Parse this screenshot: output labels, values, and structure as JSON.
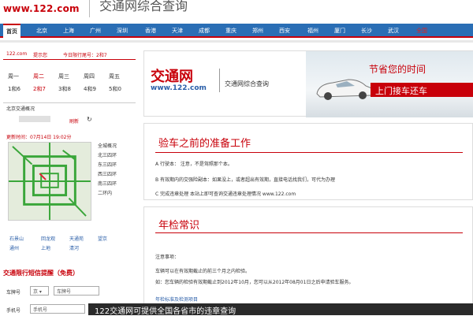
{
  "header": {
    "logo_url": "www.122.com",
    "title": "交通网综合查询"
  },
  "nav": {
    "items": [
      {
        "label": "首页",
        "type": "home"
      },
      {
        "label": "北京",
        "type": "normal"
      },
      {
        "label": "上海",
        "type": "normal"
      },
      {
        "label": "广州",
        "type": "normal"
      },
      {
        "label": "深圳",
        "type": "normal"
      },
      {
        "label": "香港",
        "type": "normal"
      },
      {
        "label": "天津",
        "type": "normal"
      },
      {
        "label": "成都",
        "type": "normal"
      },
      {
        "label": "重庆",
        "type": "normal"
      },
      {
        "label": "郑州",
        "type": "normal"
      },
      {
        "label": "西安",
        "type": "normal"
      },
      {
        "label": "福州",
        "type": "normal"
      },
      {
        "label": "厦门",
        "type": "normal"
      },
      {
        "label": "长沙",
        "type": "normal"
      },
      {
        "label": "武汉",
        "type": "normal"
      },
      {
        "label": "全国",
        "type": "red"
      }
    ]
  },
  "limit": {
    "site": "122.com",
    "tip": "提示您",
    "today": "今日限行尾号：2和7"
  },
  "week": {
    "days": [
      "周一",
      "周二",
      "周三",
      "周四",
      "周五"
    ],
    "numbers": [
      "1和6",
      "2和7",
      "3和8",
      "4和9",
      "5和0"
    ]
  },
  "traffic": {
    "title": "北京交通概况",
    "refresh": "刷新",
    "update_time": "更新时间：07月14日 19:02分",
    "roads": [
      "全城概况",
      "北三四环",
      "东三四环",
      "西三四环",
      "南三四环",
      "二环内"
    ],
    "areas": [
      "石景山",
      "回龙观",
      "天通苑",
      "望京",
      "通州",
      "上地",
      "清河"
    ]
  },
  "sms": {
    "title": "交通限行短信提醒（免费）",
    "plate_label": "车牌号",
    "province": "京",
    "plate_placeholder": "车牌号",
    "phone_label": "手机号",
    "phone_placeholder": "手机号"
  },
  "banner": {
    "logo": "交通网",
    "url": "www.122.com",
    "title": "交通网综合查询",
    "slogan1": "节省您的时间",
    "slogan2": "上门接车还车"
  },
  "inspection": {
    "heading": "验车之前的准备工作",
    "rows": [
      "A 行驶本：  注意，不是驾照那个本。",
      "B 有效期内的交强险副本：如果没上，或者超出有效期，直接电话找我们，可代为办理",
      "C 完成违章处理  本站上即可查询交通违章处理情况 www.122.com"
    ]
  },
  "knowledge": {
    "heading": "年检常识",
    "notes_title": "注意事项：",
    "rows": [
      "车辆可以在有效期截止的前三个月之内检验。",
      "如：您车辆的检验有效期截止到2012年10月，您可以从2012年08月01日之后申请验车服务。",
      "年检标准及检测项目"
    ]
  },
  "caption": "122交通网可提供全国各省市的违章查询"
}
